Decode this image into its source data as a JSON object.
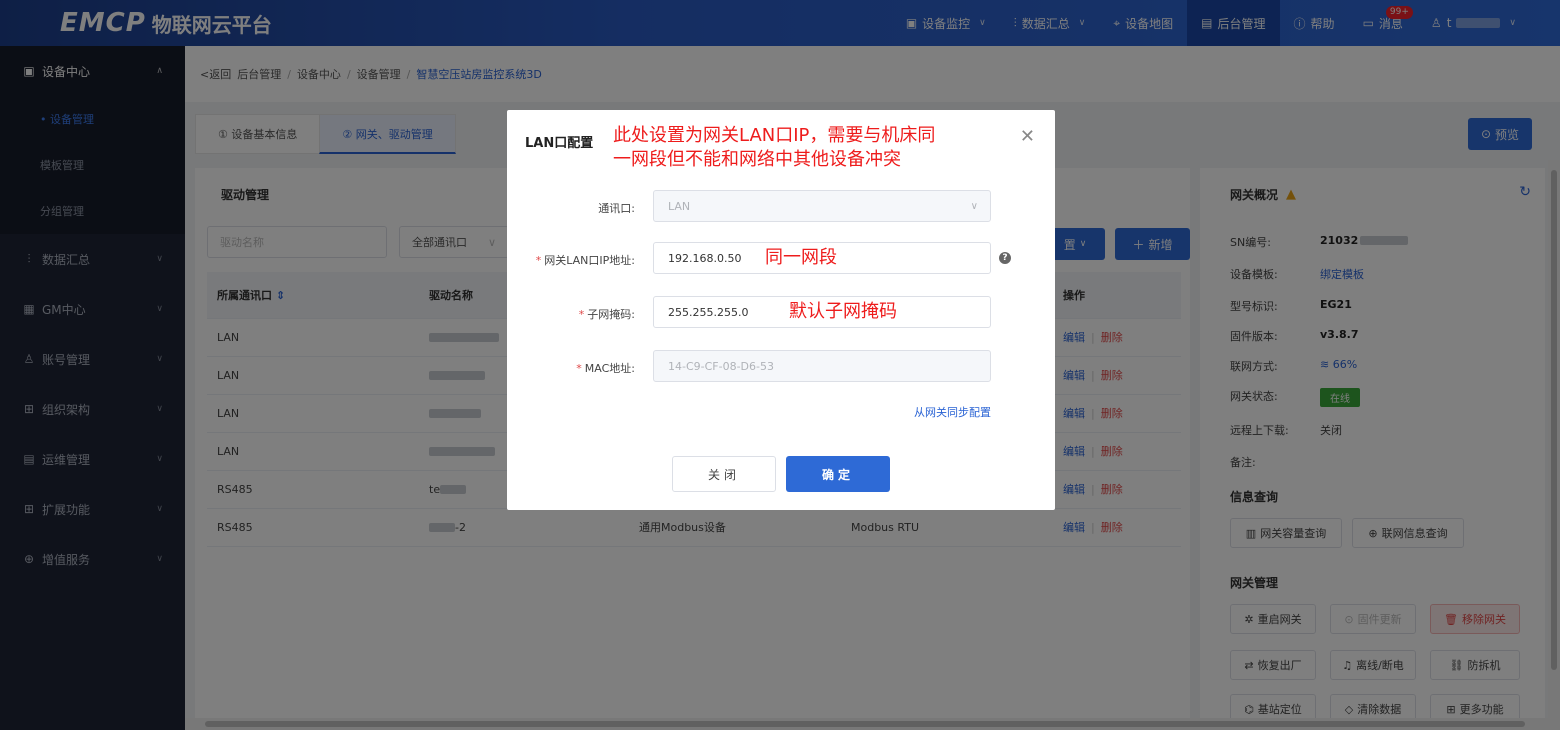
{
  "topbar": {
    "logo": "EMCP",
    "platform_name": "物联网云平台",
    "nav": [
      {
        "label": "设备监控",
        "icon": "monitor-icon"
      },
      {
        "label": "数据汇总",
        "icon": "chart-icon"
      },
      {
        "label": "设备地图",
        "icon": "location-icon"
      },
      {
        "label": "后台管理",
        "icon": "admin-icon"
      },
      {
        "label": "帮助",
        "icon": "help-icon"
      },
      {
        "label": "消息",
        "icon": "message-icon",
        "badge": "99+"
      },
      {
        "label": "t",
        "icon": "user-icon"
      }
    ]
  },
  "sidebar": {
    "groups": [
      {
        "label": "设备中心",
        "subs": [
          "• 设备管理",
          "模板管理",
          "分组管理"
        ]
      },
      {
        "label": "数据汇总"
      },
      {
        "label": "GM中心"
      },
      {
        "label": "账号管理"
      },
      {
        "label": "组织架构"
      },
      {
        "label": "运维管理"
      },
      {
        "label": "扩展功能"
      },
      {
        "label": "增值服务"
      }
    ]
  },
  "breadcrumb": {
    "back": "<返回",
    "items": [
      "后台管理",
      "设备中心",
      "设备管理",
      "智慧空压站房监控系统3D"
    ],
    "sep": "/"
  },
  "tabs": [
    "① 设备基本信息",
    "② 网关、驱动管理"
  ],
  "preview_label": "预览",
  "driver_panel": {
    "title": "驱动管理",
    "search_placeholder": "驱动名称",
    "port_filter": "全部通讯口",
    "config_button": "置",
    "new_button": "新增",
    "columns": [
      "所属通讯口",
      "驱动名称",
      "操作"
    ],
    "rows": [
      {
        "port": "LAN",
        "name_mask_w": 70,
        "name_prefix": "",
        "suffix": ""
      },
      {
        "port": "LAN",
        "name_mask_w": 56,
        "name_prefix": "",
        "suffix": ""
      },
      {
        "port": "LAN",
        "name_mask_w": 52,
        "name_prefix": "",
        "suffix": ""
      },
      {
        "port": "LAN",
        "name_mask_w": 66,
        "name_prefix": "",
        "suffix": ""
      },
      {
        "port": "RS485",
        "name_mask_w": 26,
        "name_prefix": "te",
        "suffix": ""
      },
      {
        "port": "RS485",
        "name_mask_w": 26,
        "name_prefix": "",
        "suffix": "-2",
        "col3": "通用Modbus设备",
        "col4": "Modbus RTU"
      }
    ],
    "op_edit": "编辑",
    "op_delete": "删除"
  },
  "gateway": {
    "title": "网关概况",
    "fields": [
      {
        "k": "SN编号:",
        "v": "21032"
      },
      {
        "k": "设备模板:",
        "v": "绑定模板"
      },
      {
        "k": "型号标识:",
        "v": "EG21"
      },
      {
        "k": "固件版本:",
        "v": "v3.8.7"
      },
      {
        "k": "联网方式:",
        "v": "66%"
      },
      {
        "k": "网关状态:",
        "v": "在线"
      },
      {
        "k": "远程上下载:",
        "v": "关闭"
      },
      {
        "k": "备注:",
        "v": ""
      }
    ],
    "info_title": "信息查询",
    "info_buttons": [
      "网关容量查询",
      "联网信息查询"
    ],
    "mgmt_title": "网关管理",
    "mgmt_buttons": [
      "重启网关",
      "固件更新",
      "移除网关",
      "恢复出厂",
      "离线/断电",
      "防拆机",
      "基站定位",
      "清除数据",
      "更多功能"
    ]
  },
  "modal": {
    "title": "LAN口配置",
    "annotation_top": "此处设置为网关LAN口IP，需要与机床同一网段但不能和网络中其他设备冲突",
    "annotation_top_line1": "此处设置为网关LAN口IP，需要与机床同",
    "annotation_top_line2": "一网段但不能和网络中其他设备冲突",
    "fields": {
      "port_label": "通讯口:",
      "port_value": "LAN",
      "ip_label": "网关LAN口IP地址:",
      "ip_value": "192.168.0.50",
      "ip_annotation": "同一网段",
      "mask_label": "子网掩码:",
      "mask_value": "255.255.255.0",
      "mask_annotation": "默认子网掩码",
      "mac_label": "MAC地址:",
      "mac_value": "14-C9-CF-08-D6-53"
    },
    "required_mark": "*",
    "sync_link": "从网关同步配置",
    "cancel": "关闭",
    "confirm": "确定"
  },
  "colors": {
    "primary": "#2e6ad6",
    "danger": "#e04848",
    "annotation": "#ee1c1c",
    "online": "#3aa83a"
  }
}
